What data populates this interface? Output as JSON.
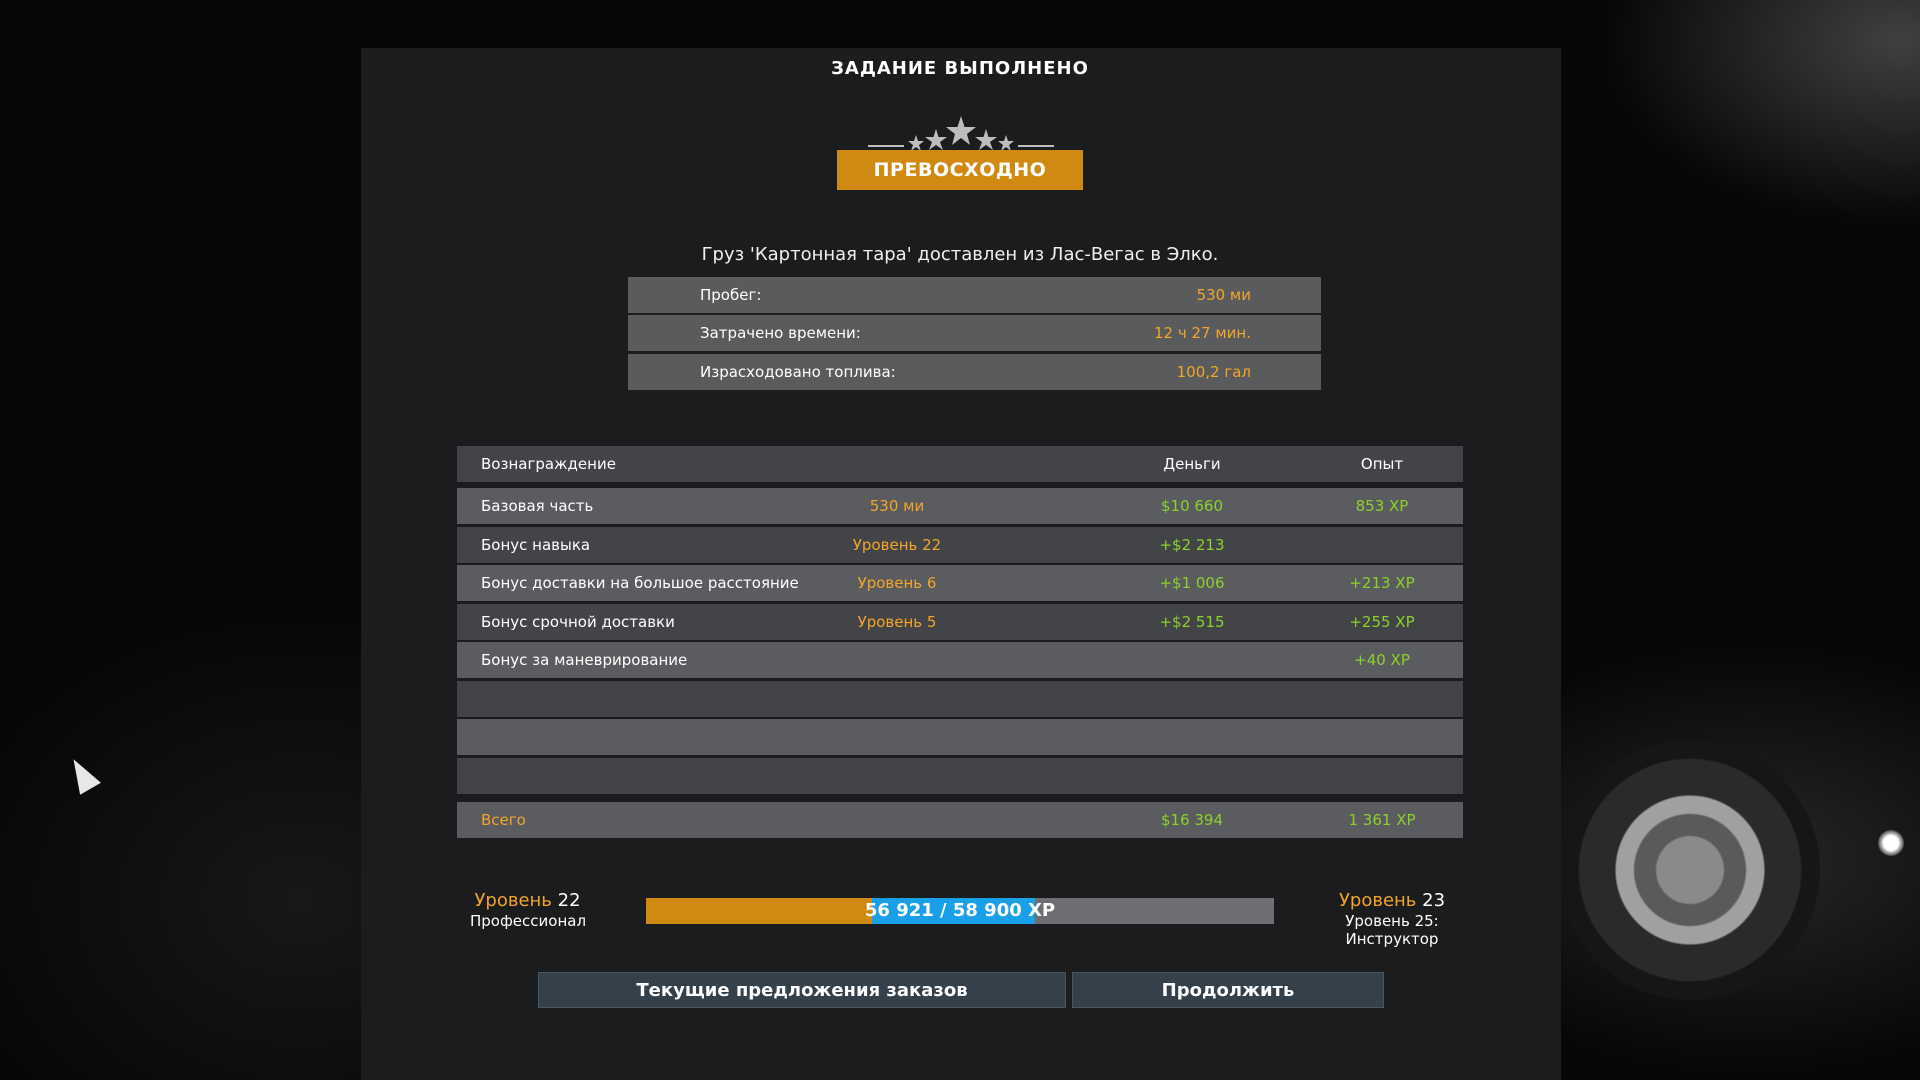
{
  "title": "ЗАДАНИЕ ВЫПОЛНЕНО",
  "rating": {
    "label": "ПРЕВОСХОДНО",
    "stars": 5,
    "colors": {
      "badge": "#d08a12",
      "stars": "#bdbdbd"
    }
  },
  "cargo_text": "Груз 'Картонная тара' доставлен из Лас-Вегас в Элко.",
  "stats": [
    {
      "label": "Пробег:",
      "value": "530 ми"
    },
    {
      "label": "Затрачено времени:",
      "value": "12 ч 27 мин."
    },
    {
      "label": "Израсходовано топлива:",
      "value": "100,2 гал"
    }
  ],
  "rewards": {
    "headers": {
      "reward": "Вознаграждение",
      "money": "Деньги",
      "xp": "Опыт"
    },
    "rows": [
      {
        "name": "Базовая часть",
        "detail": "530 ми",
        "money": "$10 660",
        "xp": "853 XP"
      },
      {
        "name": "Бонус навыка",
        "detail": "Уровень 22",
        "money": "+$2 213",
        "xp": ""
      },
      {
        "name": "Бонус доставки на большое расстояние",
        "detail": "Уровень 6",
        "money": "+$1 006",
        "xp": "+213 XP"
      },
      {
        "name": "Бонус срочной доставки",
        "detail": "Уровень 5",
        "money": "+$2 515",
        "xp": "+255 XP"
      },
      {
        "name": "Бонус за маневрирование",
        "detail": "",
        "money": "",
        "xp": "+40 XP"
      },
      {
        "name": "",
        "detail": "",
        "money": "",
        "xp": ""
      },
      {
        "name": "",
        "detail": "",
        "money": "",
        "xp": ""
      },
      {
        "name": "",
        "detail": "",
        "money": "",
        "xp": ""
      }
    ],
    "total": {
      "name": "Всего",
      "money": "$16 394",
      "xp": "1 361 XP"
    }
  },
  "level": {
    "current_prefix": "Уровень",
    "current_num": "22",
    "current_rank": "Профессионал",
    "next_prefix": "Уровень",
    "next_num": "23",
    "next_note": "Уровень 25: Инструктор",
    "xp_text": "56 921 / 58 900 XP",
    "progress_before": 0.36,
    "progress_after": 0.62,
    "colors": {
      "before": "#d08a12",
      "gained": "#1aa0e8",
      "empty": "#6e6f72"
    }
  },
  "buttons": {
    "offers": "Текущие предложения заказов",
    "continue": "Продолжить"
  },
  "icons": [
    "star-icon",
    "mouse-cursor-icon"
  ],
  "colors": {
    "accent": "#f2a52a",
    "money_green": "#8bd12a"
  }
}
